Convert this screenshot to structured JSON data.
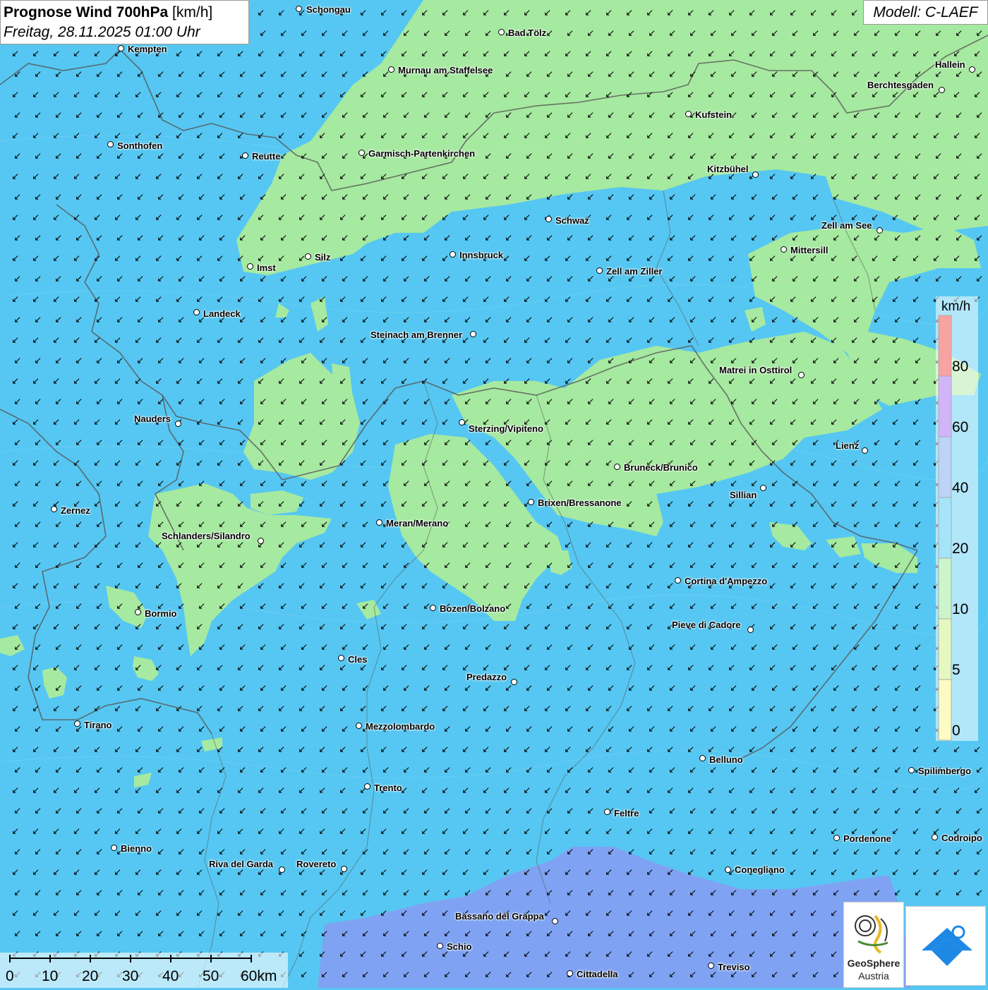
{
  "title": {
    "main": "Prognose Wind 700hPa",
    "unit": "[km/h]",
    "date": "Freitag, 28.11.2025 01:00 Uhr"
  },
  "model": "Modell: C-LAEF",
  "legend": {
    "unit": "km/h",
    "labels": [
      "80",
      "60",
      "40",
      "20",
      "10",
      "5",
      "0"
    ],
    "colors": [
      "#f03232",
      "#9b5cf0",
      "#6ea0f0",
      "#38c4f2",
      "#8ee88e",
      "#c8f078",
      "#f5f57a"
    ]
  },
  "colors": {
    "ocean_base": "#56c7f2",
    "green_zone": "#a6e9a0",
    "purple_zone": "#7fa3f2",
    "border": "#555555"
  },
  "wind": {
    "direction": "from northeast",
    "arrow_glyph": "↙"
  },
  "cities": [
    {
      "name": "Schongau"
    },
    {
      "name": "Bad Tölz"
    },
    {
      "name": "Kempten"
    },
    {
      "name": "Murnau am Staffelsee"
    },
    {
      "name": "Hallein"
    },
    {
      "name": "Berchtesgaden"
    },
    {
      "name": "Kufstein"
    },
    {
      "name": "Sonthofen"
    },
    {
      "name": "Reutte"
    },
    {
      "name": "Garmisch-Partenkirchen"
    },
    {
      "name": "Kitzbühel"
    },
    {
      "name": "Schwaz"
    },
    {
      "name": "Zell am See"
    },
    {
      "name": "Silz"
    },
    {
      "name": "Innsbruck"
    },
    {
      "name": "Mittersill"
    },
    {
      "name": "Imst"
    },
    {
      "name": "Zell am Ziller"
    },
    {
      "name": "Landeck"
    },
    {
      "name": "Steinach am Brenner"
    },
    {
      "name": "Matrei in Osttirol"
    },
    {
      "name": "Nauders"
    },
    {
      "name": "Sterzing/Vipiteno"
    },
    {
      "name": "Lienz"
    },
    {
      "name": "Bruneck/Brunico"
    },
    {
      "name": "Sillian"
    },
    {
      "name": "Zernez"
    },
    {
      "name": "Brixen/Bressanone"
    },
    {
      "name": "Meran/Merano"
    },
    {
      "name": "Schlanders/Silandro"
    },
    {
      "name": "Cortina d'Ampezzo"
    },
    {
      "name": "Bormio"
    },
    {
      "name": "Bozen/Bolzano"
    },
    {
      "name": "Pieve di Cadore"
    },
    {
      "name": "Cles"
    },
    {
      "name": "Predazzo"
    },
    {
      "name": "Tirano"
    },
    {
      "name": "Mezzolombardo"
    },
    {
      "name": "Belluno"
    },
    {
      "name": "Spilimbergo"
    },
    {
      "name": "Trento"
    },
    {
      "name": "Feltre"
    },
    {
      "name": "Bienno"
    },
    {
      "name": "Pordenone"
    },
    {
      "name": "Codroipo"
    },
    {
      "name": "Riva del Garda"
    },
    {
      "name": "Rovereto"
    },
    {
      "name": "Conegliano"
    },
    {
      "name": "Bassano del Grappa"
    },
    {
      "name": "Schio"
    },
    {
      "name": "Treviso"
    },
    {
      "name": "Cittadella"
    }
  ],
  "scale": {
    "labels": [
      "0",
      "10",
      "20",
      "30",
      "40",
      "50",
      "60km"
    ]
  },
  "logos": {
    "geosphere_line1": "GeoSphere",
    "geosphere_line2": "Austria"
  }
}
